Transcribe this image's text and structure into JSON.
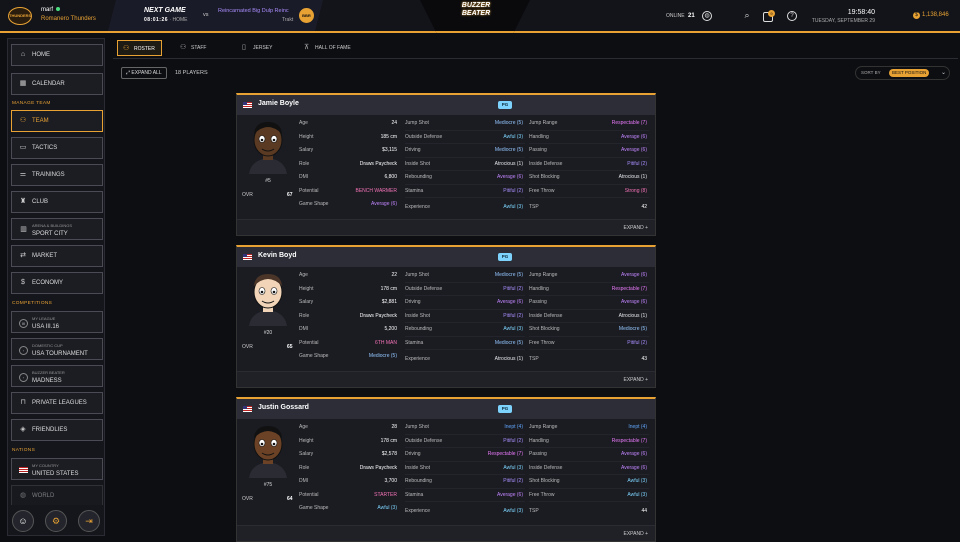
{
  "top": {
    "logo_text": "THUNDERS",
    "username": "marf",
    "team": "Romanero Thunders",
    "next_game_title": "NEXT GAME",
    "next_game_time": "08:01:26",
    "next_game_loc": "· HOME",
    "vs": "vs",
    "opponent": "Reincarnated Big Dulp Reinc",
    "opponent_sub": "Trakt",
    "opponent_badge": "BBR",
    "center_logo": "BUZZER BEATER",
    "online_label": "ONLINE",
    "online_count": "21",
    "notif_count": "9",
    "time": "19:58:40",
    "date": "TUESDAY, SEPTEMBER 29",
    "coins": "1,138,846"
  },
  "sidebar": {
    "home": "HOME",
    "calendar": "CALENDAR",
    "manage_team": "MANAGE TEAM",
    "team": "TEAM",
    "tactics": "TACTICS",
    "trainings": "TRAININGS",
    "club": "CLUB",
    "arena_small": "ARENA & BUILDINGS",
    "arena": "SPORT CITY",
    "market": "MARKET",
    "economy": "ECONOMY",
    "competitions": "COMPETITIONS",
    "league_small": "MY LEAGUE",
    "league": "USA III.16",
    "cup_small": "DOMESTIC CUP",
    "cup": "USA TOURNAMENT",
    "madness_small": "BUZZER BEATER",
    "madness": "MADNESS",
    "private": "PRIVATE LEAGUES",
    "friendlies": "FRIENDLIES",
    "nations": "NATIONS",
    "country_small": "MY COUNTRY",
    "country": "UNITED STATES",
    "world": "WORLD"
  },
  "tabs": [
    "ROSTER",
    "STAFF",
    "JERSEY",
    "HALL OF FAME"
  ],
  "toolbar": {
    "expand_all": "EXPAND ALL",
    "players": "18 PLAYERS",
    "sort_by": "SORT BY",
    "sort_value": "BEST POSITION"
  },
  "labels": {
    "age": "Age",
    "height": "Height",
    "salary": "Salary",
    "role": "Role",
    "dmi": "DMI",
    "potential": "Potential",
    "game_shape": "Game Shape",
    "ovr": "OVR",
    "jump_shot": "Jump Shot",
    "outside_defense": "Outside Defense",
    "driving": "Driving",
    "inside_shot": "Inside Shot",
    "rebounding": "Rebounding",
    "stamina": "Stamina",
    "experience": "Experience",
    "jump_range": "Jump Range",
    "handling": "Handling",
    "passing": "Passing",
    "inside_defense": "Inside Defense",
    "shot_blocking": "Shot Blocking",
    "free_throw": "Free Throw",
    "tsp": "TSP",
    "expand": "EXPAND +"
  },
  "players": [
    {
      "name": "Jamie Boyle",
      "pos": "PG",
      "number": "#5",
      "ovr": "67",
      "age": "24",
      "height": "185 cm",
      "salary": "$3,115",
      "role": "Draws Paycheck",
      "dmi": "6,800",
      "potential": "BENCH WARMER",
      "game_shape": "Average (6)",
      "jump_shot": "Mediocre (5)",
      "outside_defense": "Awful (3)",
      "driving": "Mediocre (5)",
      "inside_shot": "Atrocious (1)",
      "rebounding": "Average (6)",
      "stamina": "Pitiful (2)",
      "experience": "Awful (3)",
      "jump_range": "Respectable (7)",
      "handling": "Average (6)",
      "passing": "Average (6)",
      "inside_defense": "Pitiful (2)",
      "shot_blocking": "Atrocious (1)",
      "free_throw": "Strong (8)",
      "tsp": "42"
    },
    {
      "name": "Kevin Boyd",
      "pos": "PG",
      "number": "#20",
      "ovr": "65",
      "age": "22",
      "height": "178 cm",
      "salary": "$2,881",
      "role": "Draws Paycheck",
      "dmi": "5,200",
      "potential": "6TH MAN",
      "game_shape": "Mediocre (5)",
      "jump_shot": "Mediocre (5)",
      "outside_defense": "Pitiful (2)",
      "driving": "Average (6)",
      "inside_shot": "Pitiful (2)",
      "rebounding": "Awful (3)",
      "stamina": "Mediocre (5)",
      "experience": "Atrocious (1)",
      "jump_range": "Average (6)",
      "handling": "Respectable (7)",
      "passing": "Average (6)",
      "inside_defense": "Atrocious (1)",
      "shot_blocking": "Mediocre (5)",
      "free_throw": "Pitiful (2)",
      "tsp": "43"
    },
    {
      "name": "Justin Gossard",
      "pos": "PG",
      "number": "#75",
      "ovr": "64",
      "age": "28",
      "height": "178 cm",
      "salary": "$2,578",
      "role": "Draws Paycheck",
      "dmi": "3,700",
      "potential": "STARTER",
      "game_shape": "Awful (3)",
      "jump_shot": "Inept (4)",
      "outside_defense": "Pitiful (2)",
      "driving": "Respectable (7)",
      "inside_shot": "Awful (3)",
      "rebounding": "Pitiful (2)",
      "stamina": "Average (6)",
      "experience": "Awful (3)",
      "jump_range": "Inept (4)",
      "handling": "Respectable (7)",
      "passing": "Average (6)",
      "inside_defense": "Average (6)",
      "shot_blocking": "Awful (3)",
      "free_throw": "Awful (3)",
      "tsp": "44"
    }
  ],
  "colors": {
    "accent": "#e8a234",
    "background": "#0d0e12",
    "card": "#1b1c22"
  }
}
